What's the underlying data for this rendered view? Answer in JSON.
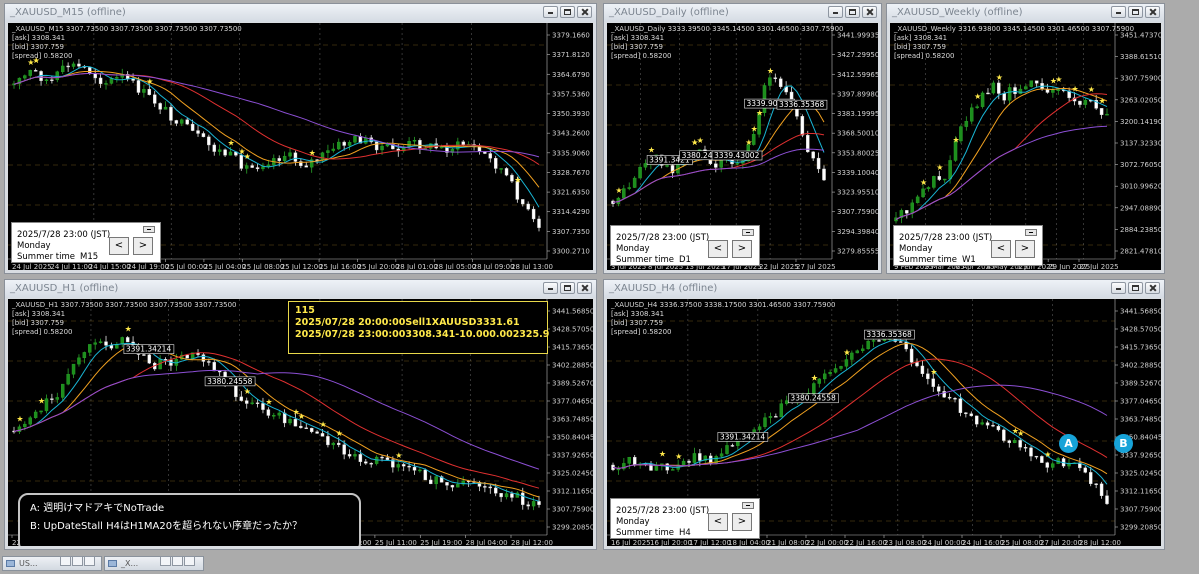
{
  "windows": [
    {
      "id": "m15",
      "title": "_XAUUSD_M15 (offline)",
      "symbol_line": "_XAUUSD_M15  3307.73500 3307.73500 3307.73500 3307.73500",
      "ask": "[ask] 3308.341",
      "bid": "[bid] 3307.759",
      "spread": "[spread] 0.58200",
      "price_labels": [
        "3379.1660",
        "3371.8120",
        "3364.6790",
        "3357.5360",
        "3350.3930",
        "3343.2600",
        "3335.9060",
        "3328.7670",
        "3321.6350",
        "3314.4290",
        "3307.7350",
        "3300.2710"
      ],
      "time_labels": [
        "24 Jul 2025",
        "24 Jul 11:00",
        "24 Jul 15:00",
        "24 Jul 19:00",
        "25 Jul 00:00",
        "25 Jul 04:00",
        "25 Jul 08:00",
        "25 Jul 12:00",
        "25 Jul 16:00",
        "25 Jul 20:00",
        "28 Jul 01:00",
        "28 Jul 05:00",
        "28 Jul 09:00",
        "28 Jul 13:00"
      ],
      "info": {
        "datetime": "2025/7/28 23:00 (JST)",
        "day": "Monday",
        "summer": "Summer time",
        "tf": "M15"
      },
      "price_levels": [],
      "trend": [
        0.2,
        0.13,
        0.19,
        0.1,
        0.12,
        0.19,
        0.16,
        0.23,
        0.3,
        0.38,
        0.45,
        0.52,
        0.56,
        0.62,
        0.58,
        0.55,
        0.6,
        0.56,
        0.5,
        0.47,
        0.5,
        0.53,
        0.49,
        0.51,
        0.52,
        0.49,
        0.55,
        0.63,
        0.78,
        0.93
      ]
    },
    {
      "id": "d1",
      "title": "_XAUUSD_Daily (offline)",
      "symbol_line": "_XAUUSD_Daily  3333.39500 3345.14500 3301.46500 3307.75900",
      "ask": "[ask] 3308.341",
      "bid": "[bid] 3307.759",
      "spread": "[spread] 0.58200",
      "price_labels": [
        "3441.99935",
        "3427.29950",
        "3412.59965",
        "3397.89980",
        "3383.19995",
        "3368.50010",
        "3353.80025",
        "3339.10040",
        "3323.95510",
        "3307.75900",
        "3294.39840",
        "3279.85555"
      ],
      "time_labels": [
        "3 Jul 2025",
        "8 Jul 2025",
        "13 Jul 2025",
        "17 Jul 2025",
        "22 Jul 2025",
        "27 Jul 2025"
      ],
      "info": {
        "datetime": "2025/7/28 23:00 (JST)",
        "day": "Monday",
        "summer": "Summer time",
        "tf": "D1"
      },
      "price_levels": [
        "3391.3421",
        "3380.24558",
        "3339.43002",
        "3339.90056",
        "3336.35368"
      ],
      "trend": [
        0.78,
        0.72,
        0.6,
        0.55,
        0.63,
        0.58,
        0.5,
        0.62,
        0.55,
        0.6,
        0.45,
        0.15,
        0.2,
        0.35,
        0.55,
        0.7
      ]
    },
    {
      "id": "w1",
      "title": "_XAUUSD_Weekly (offline)",
      "symbol_line": "_XAUUSD_Weekly  3316.93800 3345.14500 3301.46500 3307.75900",
      "ask": "[ask] 3308.341",
      "bid": "[bid] 3307.759",
      "spread": "[spread] 0.58200",
      "price_labels": [
        "3451.47370",
        "3388.61510",
        "3307.75900",
        "3263.02050",
        "3200.14190",
        "3137.32330",
        "3072.76050",
        "3010.99620",
        "2947.08890",
        "2884.23850",
        "2821.47810"
      ],
      "time_labels": [
        "9 Feb 2025",
        "9 Mar 2025",
        "6 Apr 2025",
        "4 May 2025",
        "1 Jun 2025",
        "29 Jun 2025",
        "27 Jul 2025"
      ],
      "info": {
        "datetime": "2025/7/28 23:00 (JST)",
        "day": "Monday",
        "summer": "Summer time",
        "tf": "W1"
      },
      "price_levels": [],
      "trend": [
        0.88,
        0.82,
        0.8,
        0.72,
        0.65,
        0.68,
        0.5,
        0.38,
        0.32,
        0.25,
        0.2,
        0.28,
        0.22,
        0.24,
        0.18,
        0.22,
        0.26,
        0.2,
        0.26,
        0.3,
        0.28,
        0.32,
        0.35
      ]
    },
    {
      "id": "h1",
      "title": "_XAUUSD_H1 (offline)",
      "symbol_line": "_XAUUSD_H1  3307.73500 3307.73500 3307.73500 3307.73500",
      "ask": "[ask] 3308.341",
      "bid": "[bid] 3307.759",
      "spread": "[spread] 0.58200",
      "price_labels": [
        "3441.56850",
        "3428.57050",
        "3415.73650",
        "3402.28850",
        "3389.52670",
        "3377.04650",
        "3363.74850",
        "3350.84045",
        "3337.92650",
        "3325.02450",
        "3312.11650",
        "3307.75900",
        "3299.20850"
      ],
      "time_labels": [
        "22 Jul 2025",
        "22 Jul 18:00",
        "23 Jul 09:00",
        "23 Jul 17:00",
        "24 Jul 02:00",
        "24 Jul 10:00",
        "24 Jul 18:00",
        "25 Jul 03:00",
        "25 Jul 11:00",
        "25 Jul 19:00",
        "28 Jul 04:00",
        "28 Jul 12:00"
      ],
      "info": null,
      "price_levels": [
        "3391.34214",
        "3380.24558"
      ],
      "trend": [
        0.55,
        0.45,
        0.35,
        0.15,
        0.12,
        0.1,
        0.22,
        0.2,
        0.15,
        0.25,
        0.4,
        0.45,
        0.5,
        0.55,
        0.62,
        0.68,
        0.7,
        0.72,
        0.78,
        0.82,
        0.8,
        0.85,
        0.88,
        0.93
      ]
    },
    {
      "id": "h4",
      "title": "_XAUUSD_H4 (offline)",
      "symbol_line": "_XAUUSD_H4  3336.37500 3338.17500 3301.46500 3307.75900",
      "ask": "[ask] 3308.341",
      "bid": "[bid] 3307.759",
      "spread": "[spread] 0.58200",
      "price_labels": [
        "3441.56850",
        "3428.57050",
        "3415.73650",
        "3402.28850",
        "3389.52670",
        "3377.04650",
        "3363.74850",
        "3350.84045",
        "3337.92650",
        "3325.02450",
        "3312.11650",
        "3307.75900",
        "3299.20850"
      ],
      "time_labels": [
        "16 Jul 2025",
        "16 Jul 20:00",
        "17 Jul 12:00",
        "18 Jul 04:00",
        "21 Jul 08:00",
        "22 Jul 00:00",
        "22 Jul 16:00",
        "23 Jul 08:00",
        "24 Jul 00:00",
        "24 Jul 16:00",
        "25 Jul 08:00",
        "27 Jul 20:00",
        "28 Jul 12:00"
      ],
      "info": {
        "datetime": "2025/7/28 23:00 (JST)",
        "day": "Monday",
        "summer": "Summer time",
        "tf": "H4"
      },
      "price_levels": [
        "3391.34214",
        "3380.24558",
        "3336.35368"
      ],
      "trend": [
        0.72,
        0.7,
        0.74,
        0.72,
        0.68,
        0.7,
        0.6,
        0.52,
        0.45,
        0.38,
        0.3,
        0.22,
        0.12,
        0.08,
        0.12,
        0.25,
        0.35,
        0.45,
        0.52,
        0.58,
        0.65,
        0.72,
        0.7,
        0.76,
        0.9
      ]
    }
  ],
  "trade_box": {
    "lines": [
      "115",
      "2025/07/28  20:00:00Sell1XAUUSD3331.61",
      "2025/07/28  23:00:003308.341-10.000.002325.9"
    ]
  },
  "note": {
    "lines": [
      "A:  週明けマドアキでNoTrade",
      "B:  UpDateStall  H4はH1MA20を超られない序章だったか？"
    ]
  },
  "markers": [
    "A",
    "B"
  ],
  "nav": {
    "prev": "<",
    "next": ">"
  },
  "taskbar": [
    {
      "label": "US..."
    },
    {
      "label": "_X..."
    }
  ],
  "colors": {
    "bull": "#f0f0c0",
    "bear": "#ffffff",
    "bull_body": "#1d8f1d",
    "ma_fast": "#19b5d4",
    "ma_mid": "#f0a020",
    "ma_slow": "#e03030",
    "ma_long": "#8c4fd4",
    "grid": "#8a6a20",
    "marker": "#17a3d8",
    "trade_text": "#ffe94a"
  }
}
